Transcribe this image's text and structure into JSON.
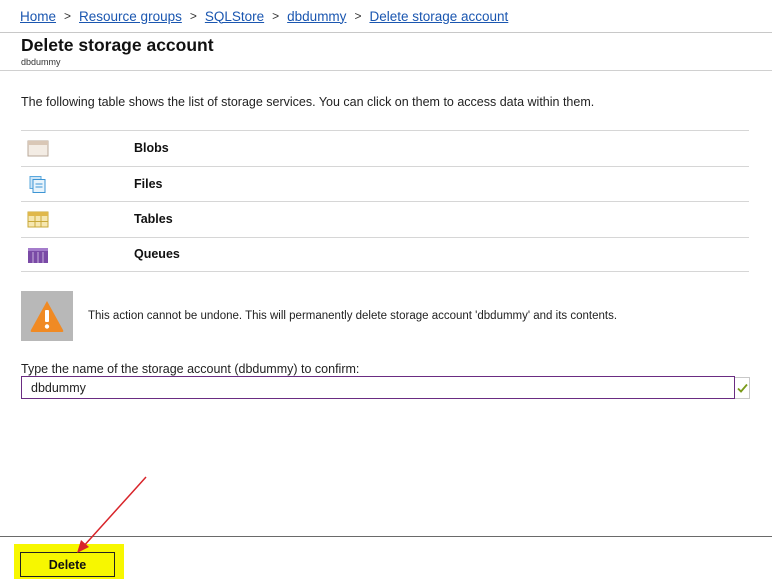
{
  "breadcrumb": {
    "items": [
      "Home",
      "Resource groups",
      "SQLStore",
      "dbdummy",
      "Delete storage account"
    ],
    "separator": ">"
  },
  "header": {
    "title": "Delete storage account",
    "subtitle": "dbdummy"
  },
  "intro_text": "The following table shows the list of storage services. You can click on them to access data within them.",
  "services": [
    {
      "label": "Blobs",
      "icon": "blob-icon"
    },
    {
      "label": "Files",
      "icon": "files-icon"
    },
    {
      "label": "Tables",
      "icon": "tables-icon"
    },
    {
      "label": "Queues",
      "icon": "queues-icon"
    }
  ],
  "warning": {
    "icon": "warning-icon",
    "text": "This action cannot be undone. This will permanently delete storage account 'dbdummy' and its contents."
  },
  "confirm": {
    "label": "Type the name of the storage account (dbdummy) to confirm:",
    "value": "dbdummy",
    "valid_icon": "checkmark-icon"
  },
  "footer": {
    "delete_label": "Delete"
  },
  "colors": {
    "link": "#1a56b0",
    "input_border": "#6a2c82",
    "highlight": "#f7f700",
    "warning_orange": "#f08a24",
    "check_green": "#7a9a1a",
    "annotation_arrow": "#d8242a"
  }
}
